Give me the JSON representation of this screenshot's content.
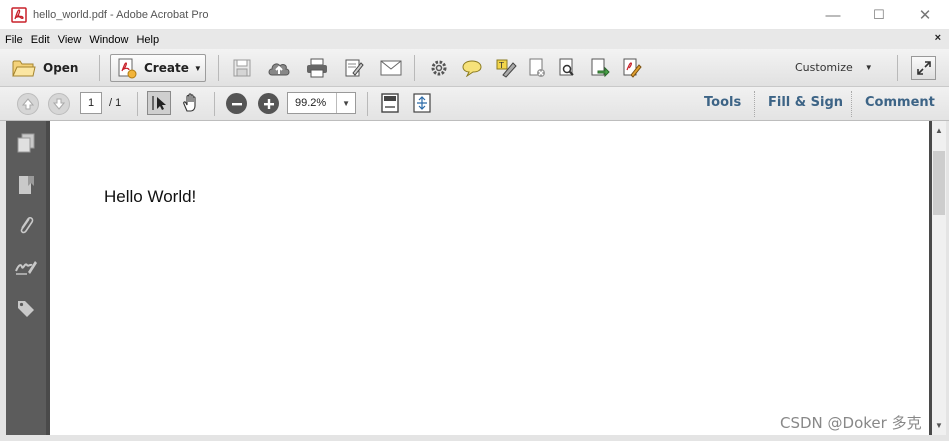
{
  "window": {
    "title": "hello_world.pdf - Adobe Acrobat Pro",
    "minimize_glyph": "—",
    "maximize_glyph": "☐",
    "close_glyph": "✕"
  },
  "menu": {
    "items": [
      "File",
      "Edit",
      "View",
      "Window",
      "Help"
    ],
    "close_glyph": "×"
  },
  "toolbar": {
    "open_label": "Open",
    "create_label": "Create",
    "customize_label": "Customize",
    "icons": [
      "save-icon",
      "upload-cloud-icon",
      "print-icon",
      "edit-document-icon",
      "email-icon",
      "settings-icon",
      "comment-icon",
      "highlight-icon",
      "document-delete-icon",
      "document-search-icon",
      "document-export-icon",
      "document-edit-icon"
    ]
  },
  "nav": {
    "page_current": "1",
    "page_total_text": "/ 1",
    "zoom_value": "99.2%",
    "tools_label": "Tools",
    "fill_sign_label": "Fill & Sign",
    "comment_label": "Comment"
  },
  "sidebar": {
    "icons": [
      "pages-icon",
      "bookmark-icon",
      "attachment-icon",
      "signature-icon",
      "tag-icon"
    ]
  },
  "document": {
    "text": "Hello World!"
  },
  "watermark": "CSDN @Doker 多克",
  "colors": {
    "link": "#3d6486",
    "sidebar": "#5c5c5c",
    "frame": "#4a4a4a",
    "pdf_red": "#c8202a"
  }
}
